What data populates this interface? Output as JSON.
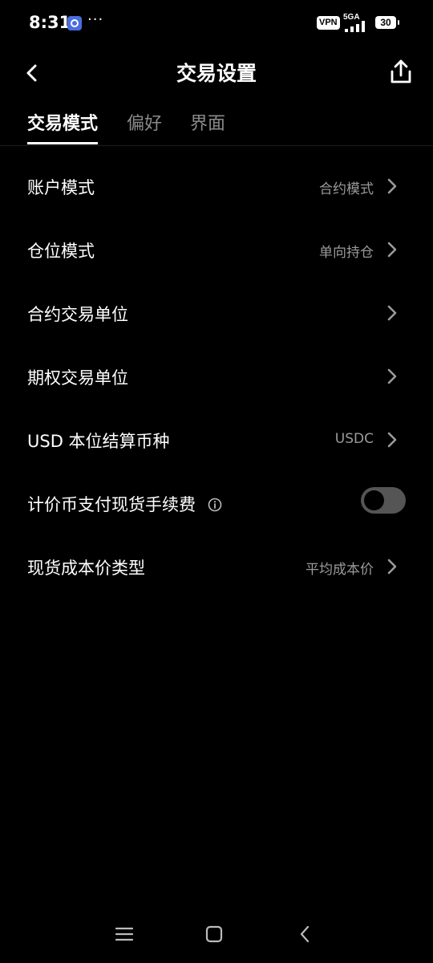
{
  "status_bar": {
    "time": "8:31",
    "dots": "···",
    "vpn": "VPN",
    "network": "5GA",
    "battery": "30"
  },
  "header": {
    "title": "交易设置"
  },
  "tabs": [
    {
      "label": "交易模式",
      "active": true
    },
    {
      "label": "偏好",
      "active": false
    },
    {
      "label": "界面",
      "active": false
    }
  ],
  "settings": {
    "account_mode": {
      "label": "账户模式",
      "value": "合约模式"
    },
    "position_mode": {
      "label": "仓位模式",
      "value": "单向持仓"
    },
    "contract_unit": {
      "label": "合约交易单位"
    },
    "options_unit": {
      "label": "期权交易单位"
    },
    "usd_settlement": {
      "label": "USD 本位结算币种",
      "value": "USDC"
    },
    "quote_fee": {
      "label": "计价币支付现货手续费",
      "toggle_on": false
    },
    "spot_cost": {
      "label": "现货成本价类型",
      "value": "平均成本价"
    }
  },
  "colors": {
    "background": "#000000",
    "text_primary": "#ffffff",
    "text_secondary": "#9a9a9a",
    "toggle_off": "#555555"
  }
}
